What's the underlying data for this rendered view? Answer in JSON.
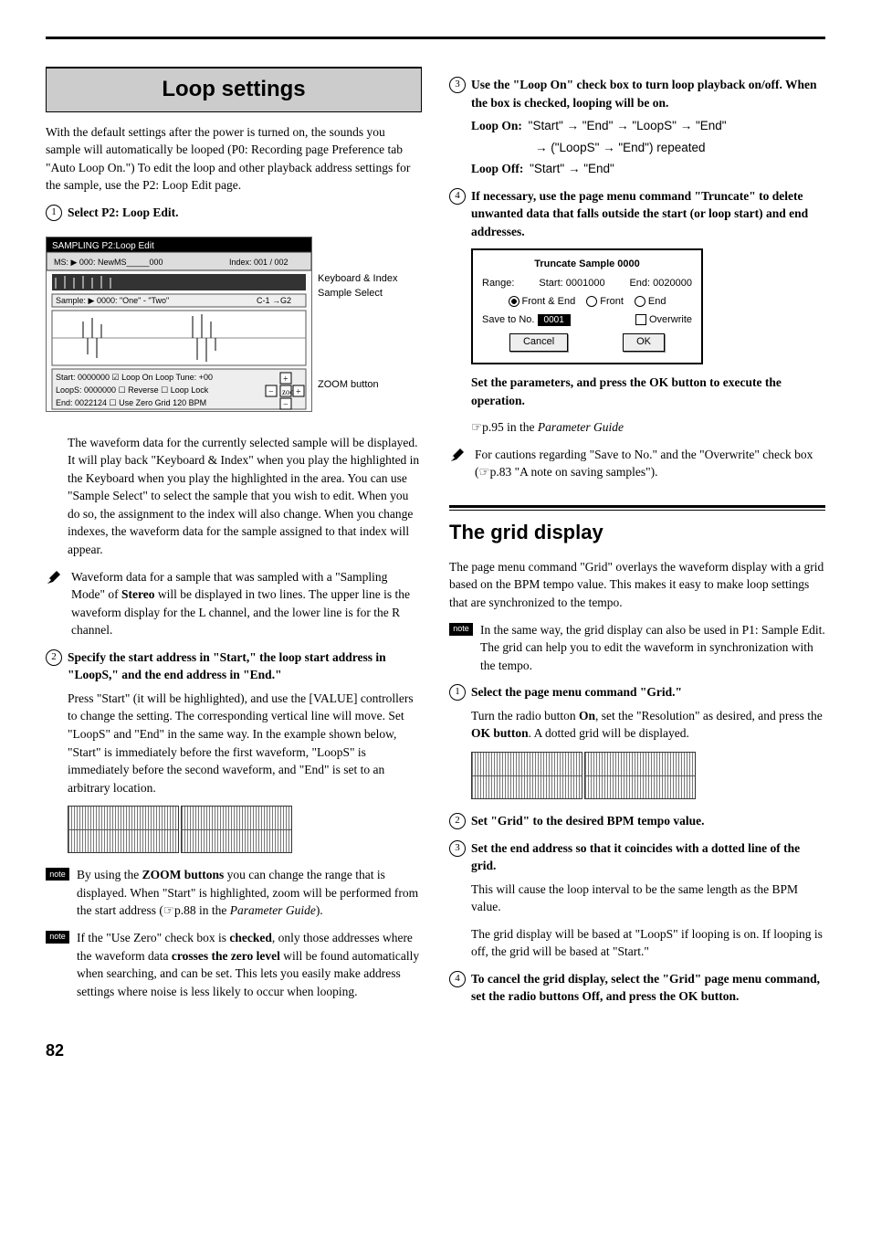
{
  "page_number": "82",
  "left": {
    "loop_title": "Loop settings",
    "intro": "With the default settings after the power is turned on, the sounds you sample will automatically be looped (P0: Recording page Preference tab \"Auto Loop On.\") To edit the loop and other playback address settings for the sample, use the P2: Loop Edit page.",
    "step1": "Select P2: Loop Edit.",
    "fig_labels": {
      "kb": "Keyboard & Index",
      "ss": "Sample Select",
      "zoom": "ZOOM button"
    },
    "para1": "The waveform data for the currently selected sample will be displayed. It will play back \"Keyboard & Index\" when you play the highlighted in the Keyboard when you play the highlighted in the area. You can use \"Sample Select\" to select the sample that you wish to edit. When you do so, the assignment to the index will also change. When you change indexes, the waveform data for the sample assigned to that index will appear.",
    "warn1a": "Waveform data for a sample that was sampled with a \"Sampling Mode\" of ",
    "warn1b": "Stereo",
    "warn1c": " will be displayed in two lines. The upper line is the waveform display for the L channel, and the lower line is for the R channel.",
    "step2": "Specify the start address in \"Start,\" the loop start address in \"LoopS,\" and the end address in \"End.\"",
    "para2": "Press \"Start\" (it will be highlighted), and use the [VALUE] controllers to change the setting. The corresponding vertical line will move. Set \"LoopS\" and \"End\" in the same way. In the example shown below, \"Start\" is immediately before the first waveform, \"LoopS\" is immediately before the second waveform, and \"End\" is set to an arbitrary location.",
    "note1a": "By using the ",
    "note1b": "ZOOM buttons",
    "note1c": " you can change the range that is displayed. When \"Start\" is highlighted, zoom will be performed from the start address (☞p.88 in the ",
    "note1d": "Parameter Guide",
    "note1e": ").",
    "note2a": "If the \"Use Zero\" check box is ",
    "note2b": "checked",
    "note2c": ", only those addresses where the waveform data ",
    "note2d": "crosses the zero level",
    "note2e": " will be found automatically when searching, and can be set. This lets you easily make address settings where noise is less likely to occur when looping."
  },
  "right": {
    "step3": "Use the \"Loop On\" check box to turn loop playback on/off. When the box is checked, looping will be on.",
    "loop_on_label": "Loop On:",
    "loop_on_val1": "\"Start\" → \"End\" → \"LoopS\" → \"End\"",
    "loop_on_val2": "→ (\"LoopS\" → \"End\") repeated",
    "loop_off_label": "Loop Off:",
    "loop_off_val": "\"Start\" → \"End\"",
    "step4": "If necessary, use the page menu command \"Truncate\" to delete unwanted data that falls outside the start (or loop start) and end addresses.",
    "dialog": {
      "title": "Truncate Sample 0000",
      "range": "Range:",
      "start": "Start: 0001000",
      "end": "End: 0020000",
      "r1": "Front & End",
      "r2": "Front",
      "r3": "End",
      "save": "Save to No.",
      "savev": "0001",
      "ov": "Overwrite",
      "cancel": "Cancel",
      "ok": "OK"
    },
    "exec": "Set the parameters, and press the OK button to execute the operation.",
    "ref": "☞p.95 in the ",
    "ref_i": "Parameter Guide",
    "warn2": "For cautions regarding \"Save to No.\" and the \"Overwrite\" check box (☞p.83 \"A note on saving samples\").",
    "grid_title": "The grid display",
    "grid_intro": "The page menu command \"Grid\" overlays the waveform display with a grid based on the BPM tempo value. This makes it easy to make loop settings that are synchronized to the tempo.",
    "grid_note": "In the same way, the grid display can also be used in P1: Sample Edit. The grid can help you to edit the waveform in synchronization with the tempo.",
    "gstep1": "Select the page menu command \"Grid.\"",
    "gpara1a": "Turn the radio button ",
    "gpara1b": "On",
    "gpara1c": ", set the \"Resolution\" as desired, and press the ",
    "gpara1d": "OK button",
    "gpara1e": ". A dotted grid will be displayed.",
    "gstep2": "Set \"Grid\" to the desired BPM tempo value.",
    "gstep3": "Set the end address so that it coincides with a dotted line of the grid.",
    "gpara3": "This will cause the loop interval to be the same length as the BPM value.",
    "gpara4": "The grid display will be based at \"LoopS\" if looping is on. If looping is off, the grid will be based at \"Start.\"",
    "gstep4": "To cancel the grid display, select the \"Grid\" page menu command, set the radio buttons Off, and press the OK button."
  }
}
